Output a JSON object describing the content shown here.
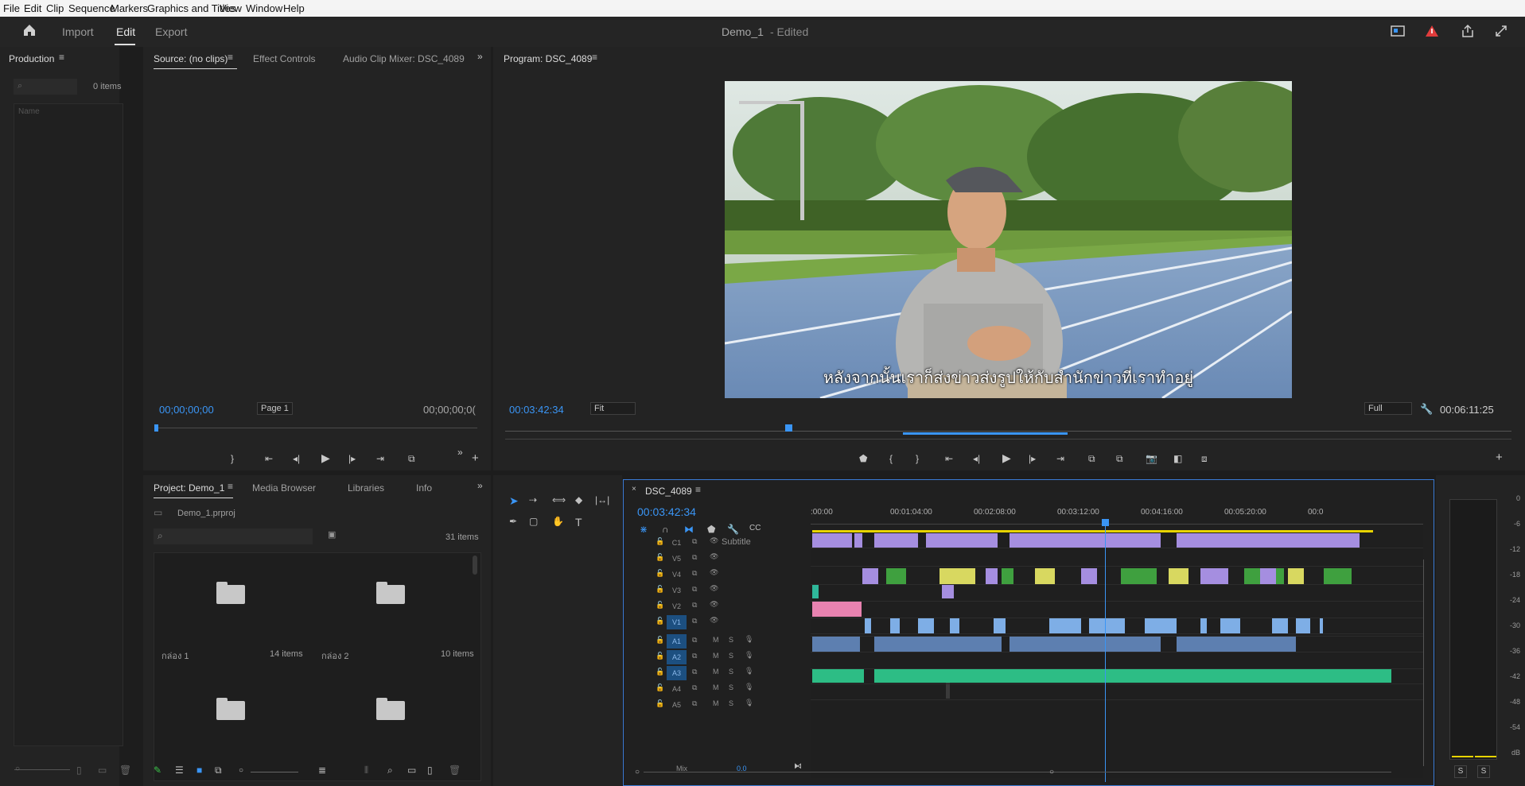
{
  "menu": [
    "File",
    "Edit",
    "Clip",
    "Sequence",
    "Markers",
    "Graphics and Titles",
    "View",
    "Window",
    "Help"
  ],
  "workspace": {
    "tabs": [
      "Import",
      "Edit",
      "Export"
    ],
    "title": "Demo_1",
    "edited": "- Edited"
  },
  "production": {
    "title": "Production",
    "items": "0 items",
    "column": "Name"
  },
  "source": {
    "tabs": [
      "Source: (no clips)",
      "Effect Controls",
      "Audio Clip Mixer: DSC_4089"
    ],
    "timecode_in": "00;00;00;00",
    "page": "Page 1",
    "timecode_out": "00;00;00;0("
  },
  "program": {
    "title": "Program: DSC_4089",
    "timecode": "00:03:42:34",
    "fit": "Fit",
    "full": "Full",
    "duration": "00:06:11:25",
    "subtitle": "หลังจากนั้นเราก็ส่งข่าวส่งรูปให้กับสำนักข่าวที่เราทำอยู่",
    "playhead_fraction": 0.56
  },
  "project": {
    "tabs": [
      "Project: Demo_1",
      "Media Browser",
      "Libraries",
      "Info"
    ],
    "file": "Demo_1.prproj",
    "count": "31 items",
    "bins": [
      {
        "name": "กล่อง 1",
        "items": "14 items"
      },
      {
        "name": "กล่อง 2",
        "items": "10 items"
      }
    ]
  },
  "timeline": {
    "sequence": "DSC_4089",
    "timecode": "00:03:42:34",
    "ruler": [
      ":00:00",
      "00:01:04:00",
      "00:02:08:00",
      "00:03:12:00",
      "00:04:16:00",
      "00:05:20:00",
      "00:0"
    ],
    "video_tracks": [
      "C1",
      "V5",
      "V4",
      "V3",
      "V2",
      "V1"
    ],
    "audio_tracks": [
      "A1",
      "A2",
      "A3",
      "A4",
      "A5"
    ],
    "subtitle_label": "Subtitle",
    "mix_label": "Mix",
    "mix_value": "0.0"
  },
  "meter": {
    "labels": [
      "0",
      "-6",
      "-12",
      "-18",
      "-24",
      "-30",
      "-36",
      "-42",
      "-48",
      "-54",
      "dB"
    ],
    "solo": [
      "S",
      "S"
    ]
  },
  "colors": {
    "accent": "#3a95f5",
    "subtitle_clip": "#a58ee0",
    "video_clip": "#7eaee6",
    "audio_clip": "#2dbd85",
    "pink_clip": "#e882b0"
  }
}
